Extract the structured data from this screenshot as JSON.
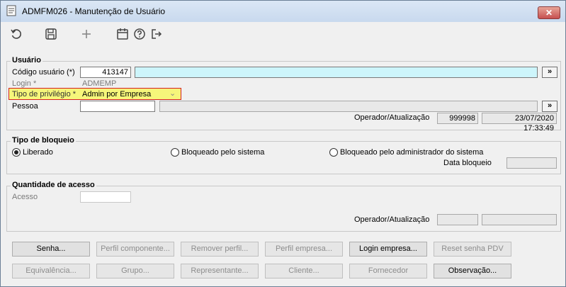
{
  "window": {
    "title": "ADMFM026 - Manutenção de Usuário",
    "close_label": "✕"
  },
  "toolbar": {
    "icons": [
      "refresh-icon",
      "save-icon",
      "add-icon",
      "calendar-icon",
      "help-icon",
      "exit-icon"
    ]
  },
  "usuario": {
    "group_title": "Usuário",
    "codigo_label": "Código usuário (*)",
    "codigo_value": "413147",
    "lookup_button": "»",
    "login_label": "Login *",
    "login_value": "ADMEMP",
    "privilegio_label": "Tipo de privilégio *",
    "privilegio_value": "Admin por Empresa",
    "privilegio_arrow": "⌄",
    "pessoa_label": "Pessoa",
    "pessoa_button": "»",
    "operador_label": "Operador/Atualização",
    "operador_value": "999998",
    "data_value": "23/07/2020 17:33:49"
  },
  "bloqueio": {
    "group_title": "Tipo de bloqueio",
    "options": [
      "Liberado",
      "Bloqueado pelo sistema",
      "Bloqueado pelo administrador do sistema"
    ],
    "selected": "Liberado",
    "data_label": "Data bloqueio"
  },
  "acesso": {
    "group_title": "Quantidade de acesso",
    "acesso_label": "Acesso",
    "operador_label": "Operador/Atualização"
  },
  "buttons": {
    "row1": [
      "Senha...",
      "Perfil componente...",
      "Remover perfil...",
      "Perfil empresa...",
      "Login empresa...",
      "Reset senha PDV"
    ],
    "row2": [
      "Equivalência...",
      "Grupo...",
      "Representante...",
      "Cliente...",
      "Fornecedor",
      "Observação..."
    ]
  }
}
